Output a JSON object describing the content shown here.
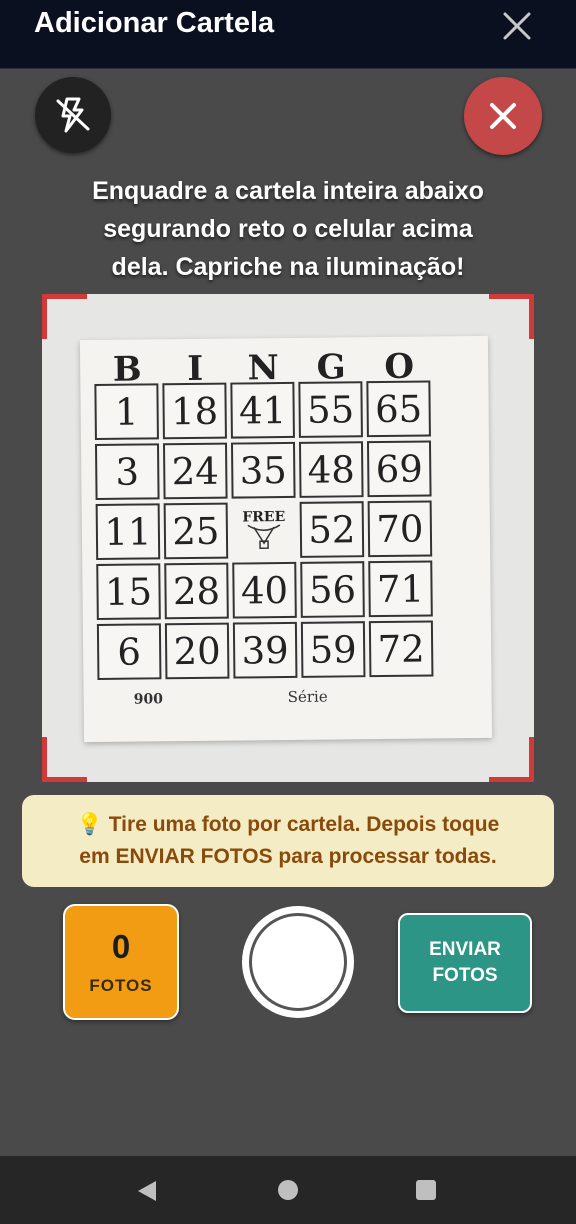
{
  "header": {
    "title": "Adicionar Cartela",
    "close_icon": "close-icon"
  },
  "camera": {
    "flash_icon": "flash-off-icon",
    "cancel_icon": "close-icon",
    "cancel_color": "#c44848"
  },
  "instruction": {
    "line1": "Enquadre a cartela inteira abaixo",
    "line2": "segurando reto o celular acima",
    "line3": "dela. Capriche na iluminação!"
  },
  "preview": {
    "header_letters": [
      "B",
      "I",
      "N",
      "G",
      "O"
    ],
    "rows": [
      [
        "1",
        "18",
        "41",
        "55",
        "65"
      ],
      [
        "3",
        "24",
        "35",
        "48",
        "69"
      ],
      [
        "11",
        "25",
        "FREE",
        "52",
        "70"
      ],
      [
        "15",
        "28",
        "40",
        "56",
        "71"
      ],
      [
        "6",
        "20",
        "39",
        "59",
        "72"
      ]
    ],
    "card_number": "900",
    "serie_label": "Série"
  },
  "tip": {
    "icon": "lightbulb-icon",
    "line1": "Tire uma foto por cartela. Depois toque",
    "line2": "em ENVIAR FOTOS para processar todas."
  },
  "controls": {
    "fotos_count": "0",
    "fotos_label": "FOTOS",
    "send_line1": "ENVIAR",
    "send_line2": "FOTOS",
    "fotos_color": "#f19c12",
    "send_color": "#2c9585"
  },
  "navbar": {
    "back_icon": "back-icon",
    "home_icon": "home-icon",
    "recent_icon": "recent-apps-icon"
  }
}
